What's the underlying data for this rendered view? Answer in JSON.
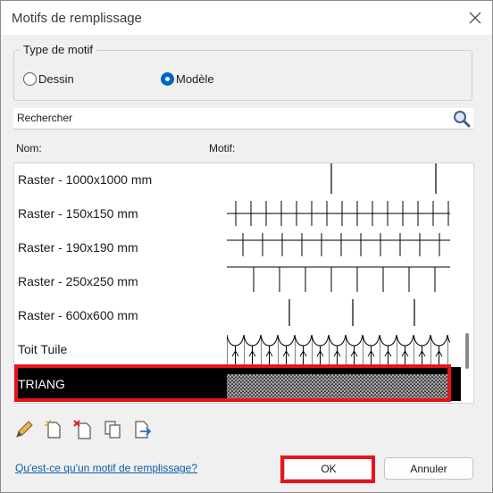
{
  "window": {
    "title": "Motifs de remplissage"
  },
  "pattern_type": {
    "legend": "Type de motif",
    "options": [
      {
        "label": "Dessin",
        "checked": false
      },
      {
        "label": "Modèle",
        "checked": true
      }
    ]
  },
  "search": {
    "value": "Rechercher"
  },
  "columns": {
    "name": "Nom:",
    "pattern": "Motif:"
  },
  "list": {
    "rows": [
      {
        "label": "Raster - 1000x1000 mm",
        "pattern": "raster-1000"
      },
      {
        "label": "Raster - 150x150 mm",
        "pattern": "raster-150"
      },
      {
        "label": "Raster - 190x190 mm",
        "pattern": "raster-190"
      },
      {
        "label": "Raster - 250x250 mm",
        "pattern": "raster-250"
      },
      {
        "label": "Raster - 600x600 mm",
        "pattern": "raster-600"
      },
      {
        "label": "Toit Tuile",
        "pattern": "roof-tile"
      },
      {
        "label": "TRIANG",
        "pattern": "triangle-hatch",
        "selected": true
      }
    ]
  },
  "toolbar": {
    "tools": [
      "pencil-icon",
      "new-pattern-icon",
      "delete-pattern-icon",
      "duplicate-icon",
      "export-icon"
    ]
  },
  "footer": {
    "help_link": "Qu'est-ce qu'un motif de remplissage?",
    "ok_label": "OK",
    "cancel_label": "Annuler"
  },
  "colors": {
    "accent": "#0067c0",
    "highlight": "#e8141c",
    "link": "#0b5ea8"
  }
}
